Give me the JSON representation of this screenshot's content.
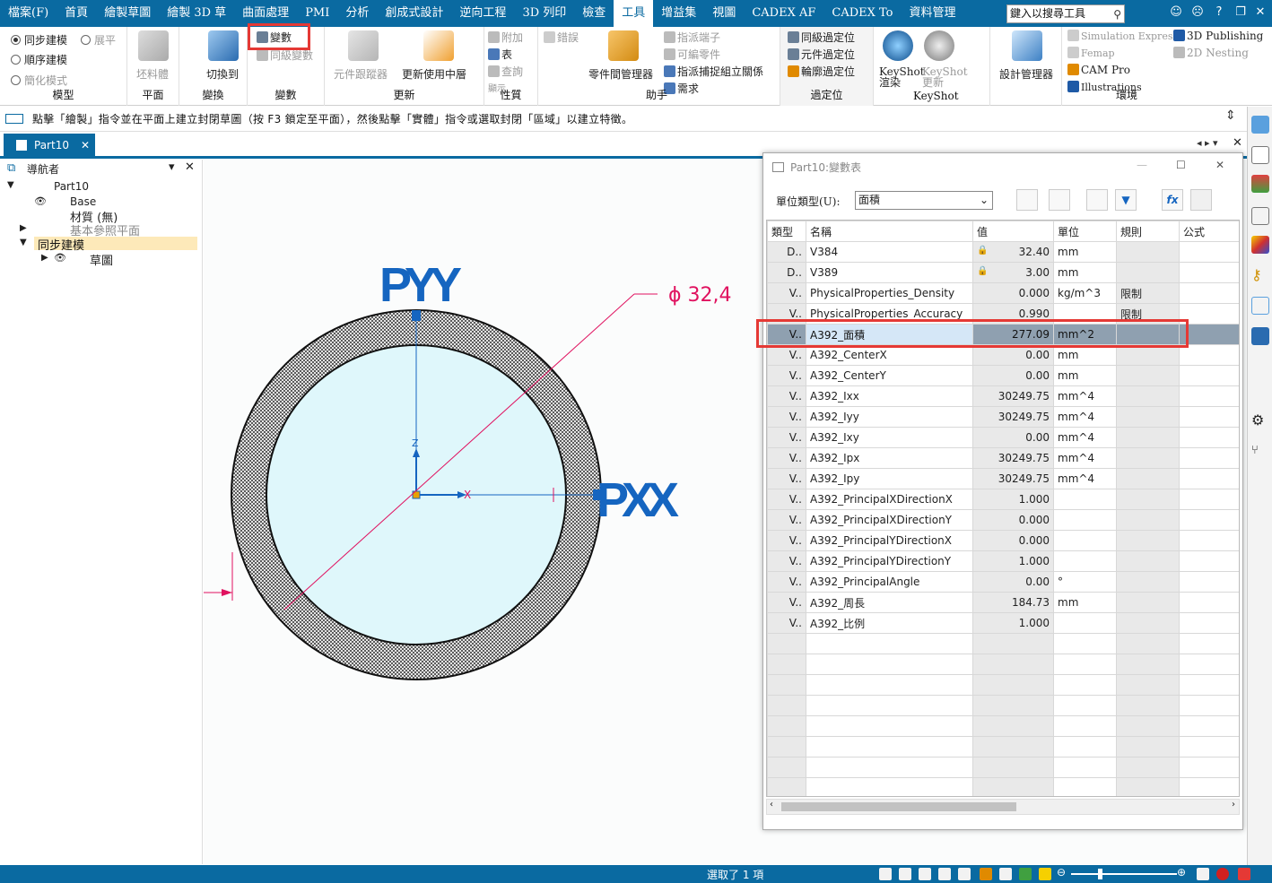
{
  "menu": {
    "items": [
      "檔案(F)",
      "首頁",
      "繪製草圖",
      "繪製 3D 草",
      "曲面處理",
      "PMI",
      "分析",
      "創成式設計",
      "逆向工程",
      "3D 列印",
      "檢查",
      "工具",
      "增益集",
      "視圖",
      "CADEX AF",
      "CADEX To",
      "資料管理"
    ],
    "active_index": 11,
    "search_placeholder": "鍵入以搜尋工具"
  },
  "ribbon": {
    "model": {
      "sync": "同步建模",
      "ordered": "順序建模",
      "simplified": "簡化模式",
      "flat": "展平",
      "label": "模型"
    },
    "plane": {
      "blank": "坯料體",
      "label": "平面"
    },
    "transform": {
      "switch": "切換到",
      "label": "變換"
    },
    "variables": {
      "var": "變數",
      "sync_var": "同級變數",
      "label": "變數"
    },
    "update": {
      "tracker": "元件跟蹤器",
      "update_active": "更新使用中層",
      "label": "更新"
    },
    "properties": {
      "attach": "附加",
      "table": "表",
      "query": "查詢",
      "show": "顯示",
      "label": "性質"
    },
    "assistant": {
      "errors": "錯誤",
      "part_mgr": "零件間管理器",
      "assign_ends": "指派端子",
      "editable_parts": "可編零件",
      "assign_capture": "指派捕捉組立關係",
      "requirements": "需求",
      "label": "助手"
    },
    "peer": {
      "peer_pos": "同級過定位",
      "comp_pos": "元件過定位",
      "profile_pos": "輪廓過定位",
      "label": "過定位"
    },
    "keyshot": {
      "render": "KeyShot 渲染",
      "update": "KeyShot 更新",
      "label": "KeyShot"
    },
    "design_mgr": {
      "label": "設計管理器"
    },
    "env": {
      "sim": "Simulation Express",
      "femap": "Femap",
      "cam": "CAM Pro",
      "illus": "Illustrations",
      "pub": "3D Publishing",
      "nest": "2D Nesting",
      "label": "環境"
    }
  },
  "prompt": "點擊「繪製」指令並在平面上建立封閉草圖（按 F3 鎖定至平面），然後點擊「實體」指令或選取封閉「區域」以建立特徵。",
  "doc_tab": "Part10",
  "navigator": {
    "title": "導航者",
    "root": "Part10",
    "base": "Base",
    "material": "材質 (無)",
    "ref_planes": "基本參照平面",
    "sync": "同步建模",
    "sketch": "草圖"
  },
  "canvas": {
    "dim_label": "ϕ 32,4",
    "pyy": "PYY",
    "pxx": "PXX",
    "z": "Z",
    "x": "X"
  },
  "var_table": {
    "title": "Part10:變數表",
    "unit_type_label": "單位類型(U):",
    "unit_type_value": "面積",
    "headers": [
      "類型",
      "名稱",
      "值",
      "單位",
      "規則",
      "公式"
    ],
    "rows": [
      {
        "t": "D..",
        "name": "V384",
        "lock": true,
        "val": "32.40",
        "unit": "mm",
        "rule": ""
      },
      {
        "t": "D..",
        "name": "V389",
        "lock": true,
        "val": "3.00",
        "unit": "mm",
        "rule": ""
      },
      {
        "t": "V..",
        "name": "PhysicalProperties_Density",
        "lock": false,
        "val": "0.000",
        "unit": "kg/m^3",
        "rule": "限制"
      },
      {
        "t": "V..",
        "name": "PhysicalProperties_Accuracy",
        "lock": false,
        "val": "0.990",
        "unit": "",
        "rule": "限制"
      },
      {
        "t": "V..",
        "name": "A392_面積",
        "lock": false,
        "val": "277.09",
        "unit": "mm^2",
        "rule": "",
        "selected": true
      },
      {
        "t": "V..",
        "name": "A392_CenterX",
        "lock": false,
        "val": "0.00",
        "unit": "mm",
        "rule": ""
      },
      {
        "t": "V..",
        "name": "A392_CenterY",
        "lock": false,
        "val": "0.00",
        "unit": "mm",
        "rule": ""
      },
      {
        "t": "V..",
        "name": "A392_Ixx",
        "lock": false,
        "val": "30249.75",
        "unit": "mm^4",
        "rule": ""
      },
      {
        "t": "V..",
        "name": "A392_Iyy",
        "lock": false,
        "val": "30249.75",
        "unit": "mm^4",
        "rule": ""
      },
      {
        "t": "V..",
        "name": "A392_Ixy",
        "lock": false,
        "val": "0.00",
        "unit": "mm^4",
        "rule": ""
      },
      {
        "t": "V..",
        "name": "A392_Ipx",
        "lock": false,
        "val": "30249.75",
        "unit": "mm^4",
        "rule": ""
      },
      {
        "t": "V..",
        "name": "A392_Ipy",
        "lock": false,
        "val": "30249.75",
        "unit": "mm^4",
        "rule": ""
      },
      {
        "t": "V..",
        "name": "A392_PrincipalXDirectionX",
        "lock": false,
        "val": "1.000",
        "unit": "",
        "rule": ""
      },
      {
        "t": "V..",
        "name": "A392_PrincipalXDirectionY",
        "lock": false,
        "val": "0.000",
        "unit": "",
        "rule": ""
      },
      {
        "t": "V..",
        "name": "A392_PrincipalYDirectionX",
        "lock": false,
        "val": "0.000",
        "unit": "",
        "rule": ""
      },
      {
        "t": "V..",
        "name": "A392_PrincipalYDirectionY",
        "lock": false,
        "val": "1.000",
        "unit": "",
        "rule": ""
      },
      {
        "t": "V..",
        "name": "A392_PrincipalAngle",
        "lock": false,
        "val": "0.00",
        "unit": "°",
        "rule": ""
      },
      {
        "t": "V..",
        "name": "A392_周長",
        "lock": false,
        "val": "184.73",
        "unit": "mm",
        "rule": ""
      },
      {
        "t": "V..",
        "name": "A392_比例",
        "lock": false,
        "val": "1.000",
        "unit": "",
        "rule": ""
      }
    ]
  },
  "status": {
    "text": "選取了 1 項"
  },
  "colors": {
    "brand": "#0a6aa1",
    "highlight": "#e53935",
    "axis": "#1565c0",
    "dim": "#e0115f"
  }
}
